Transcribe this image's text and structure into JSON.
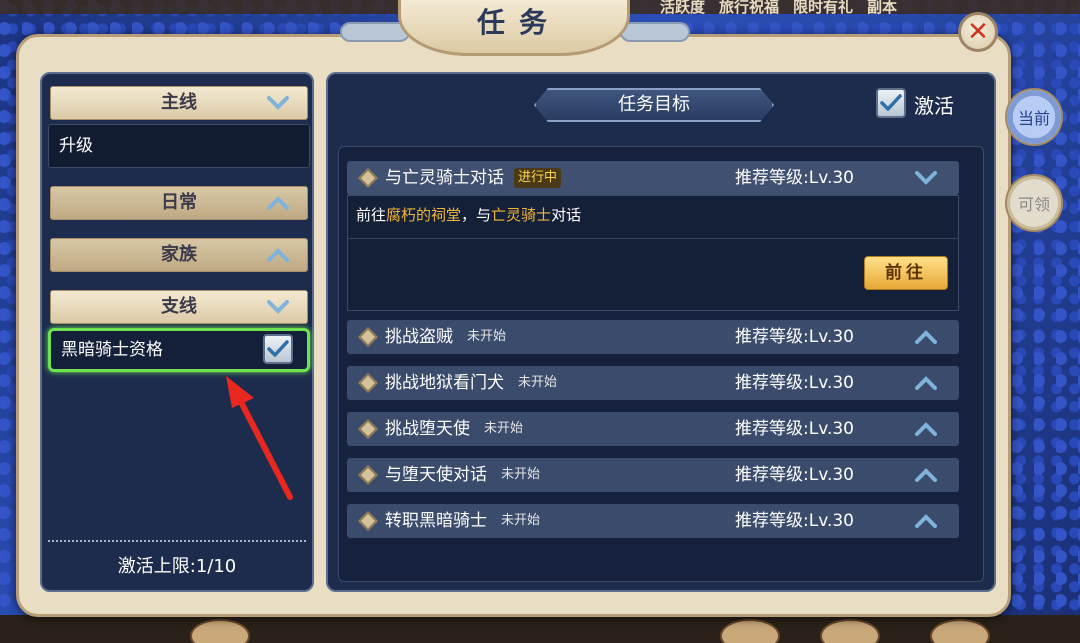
{
  "window": {
    "title": "任务",
    "close_icon": "close-icon"
  },
  "background_tabs": [
    "活跃度",
    "旅行祝福",
    "限时有礼",
    "副本"
  ],
  "categories": [
    {
      "label": "主线",
      "state": "expanded"
    },
    {
      "label": "日常",
      "state": "collapsed"
    },
    {
      "label": "家族",
      "state": "collapsed"
    },
    {
      "label": "支线",
      "state": "expanded"
    }
  ],
  "main_quest": {
    "name": "升级"
  },
  "side_quest": {
    "name": "黑暗骑士资格",
    "checked": true
  },
  "activation_limit": "激活上限:1/10",
  "right_panel": {
    "goal_title": "任务目标",
    "activate_label": "激活",
    "activate_checked": true
  },
  "tasks": [
    {
      "name": "与亡灵骑士对话",
      "status": "进行中",
      "level": "推荐等级:Lv.30",
      "expanded": true
    },
    {
      "name": "挑战盗贼",
      "status": "未开始",
      "level": "推荐等级:Lv.30",
      "expanded": false
    },
    {
      "name": "挑战地狱看门犬",
      "status": "未开始",
      "level": "推荐等级:Lv.30",
      "expanded": false
    },
    {
      "name": "挑战堕天使",
      "status": "未开始",
      "level": "推荐等级:Lv.30",
      "expanded": false
    },
    {
      "name": "与堕天使对话",
      "status": "未开始",
      "level": "推荐等级:Lv.30",
      "expanded": false
    },
    {
      "name": "转职黑暗骑士",
      "status": "未开始",
      "level": "推荐等级:Lv.30",
      "expanded": false
    }
  ],
  "task_detail": {
    "prefix": "前往",
    "place": "腐朽的祠堂",
    "middle": "，与",
    "npc": "亡灵骑士",
    "suffix": "对话",
    "go_button": "前往"
  },
  "side_buttons": {
    "current": "当前",
    "claimable": "可领"
  },
  "colors": {
    "highlight": "#f0b63c",
    "selection": "#6ee34f",
    "close": "#d2311f"
  }
}
